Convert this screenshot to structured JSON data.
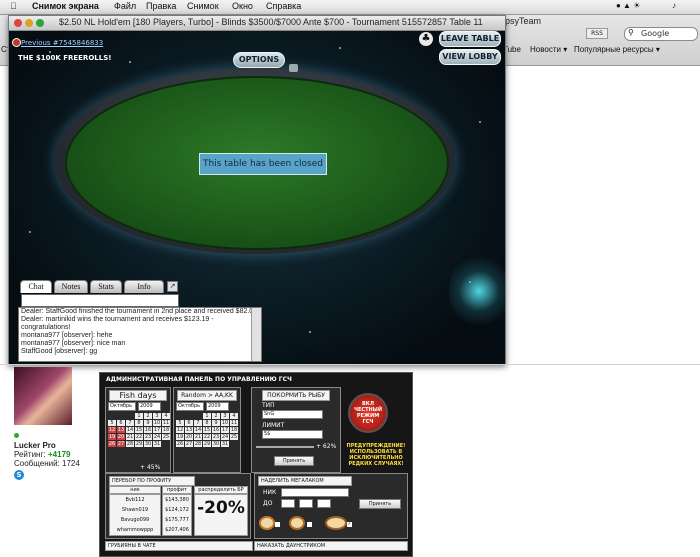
{
  "menubar": {
    "app": "Снимок экрана",
    "items": [
      "Файл",
      "Правка",
      "Снимок",
      "Окно",
      "Справка"
    ]
  },
  "browser": {
    "search_placeholder": "Google",
    "rss": "RSS",
    "bookmarks": [
      "Tube",
      "Новости ▾",
      "Популярные ресурсы ▾"
    ],
    "left_fragment": "Ст"
  },
  "poker_window": {
    "title": "$2.50 NL Hold'em [180 Players, Turbo] - Blinds $3500/$7000 Ante $700 - Tournament 515572857 Table 11",
    "title_tail": "psyTeam",
    "previous_link": "Previous #7545846833",
    "freeroll": "THE $100K FREEROLLS!",
    "options": "OPTIONS",
    "leave_table": "LEAVE TABLE",
    "view_lobby": "VIEW LOBBY",
    "closed_message": "This table has been closed",
    "tabs": [
      "Chat",
      "Notes",
      "Stats",
      "Info"
    ],
    "chat_lines": [
      "Dealer: StaffGood finished the tournament in 2nd place and received $82.08.",
      "Dealer: martinikid wins the tournament and receives $123.19 -",
      "congratulations!",
      "montana977 [observer]: hehe",
      "montana977 [observer]: nice man",
      "StaffGood [observer]: gg"
    ]
  },
  "user": {
    "name": "Lucker Pro",
    "rating_label": "Рейтинг:",
    "rating_value": "+4179",
    "posts": "Сообщений: 1724"
  },
  "panel": {
    "title": "АДМИНИСТРАТИВНАЯ ПАНЕЛЬ ПО УПРАВЛЕНИЮ ГСЧ",
    "fish_days": "Fish days",
    "random": "Random > AA,KK",
    "month": "Октябрь",
    "year": "2009",
    "slider_percent": "+ 45%",
    "feed_title": "ПОКОРМИТЬ РЫБУ",
    "type_label": "ТИП",
    "type_value": "SnG",
    "limit_label": "ЛИМИТ",
    "limit_value": "5$",
    "limit_percent": "+ 62%",
    "apply": "Принять",
    "mode_text": "ВКЛ ЧЕСТНЫЙ РЕЖИМ ГСЧ",
    "warning": "ПРЕДУПРЕЖДЕНИЕ! ИСПОЛЬЗОВАТЬ В ИСКЛЮЧИТЕЛЬНО РЕДКИХ СЛУЧАЯХ!",
    "profit_title": "ПЕРЕБОР ПО ПРОФИТУ",
    "col_nick": "ник",
    "col_profit": "профит",
    "col_distribute": "распределить БР",
    "rows": [
      {
        "nick": "Bvb112",
        "profit": "$143,380"
      },
      {
        "nick": "Shawn019",
        "profit": "$124,172"
      },
      {
        "nick": "Bavugo099",
        "profit": "$175,777"
      },
      {
        "nick": "whammowppp",
        "profit": "$207,406"
      }
    ],
    "percent_big": "-20%",
    "mega_title": "НАДЕЛИТЬ МЕГАЛАКОМ",
    "nick_label": "НИК",
    "to_label": "ДО",
    "mega_apply": "Принять",
    "rude_title": "ГРУБИЯНЫ В ЧАТЕ",
    "downstreak_title": "НАКАЗАТЬ ДАУНСТРИКОМ",
    "calendar1": [
      "",
      "",
      "",
      "1",
      "2",
      "3",
      "4",
      "5",
      "6",
      "7",
      "8",
      "9",
      "10",
      "11",
      "12",
      "13",
      "14",
      "15",
      "16",
      "17",
      "18",
      "19",
      "20",
      "21",
      "22",
      "23",
      "24",
      "25",
      "26",
      "27",
      "28",
      "29",
      "30",
      "31"
    ],
    "calendar2": [
      "",
      "",
      "",
      "1",
      "2",
      "3",
      "4",
      "5",
      "6",
      "7",
      "8",
      "9",
      "10",
      "11",
      "12",
      "13",
      "14",
      "15",
      "16",
      "17",
      "18",
      "19",
      "20",
      "21",
      "22",
      "23",
      "24",
      "25",
      "26",
      "27",
      "28",
      "29",
      "30",
      "31"
    ]
  }
}
